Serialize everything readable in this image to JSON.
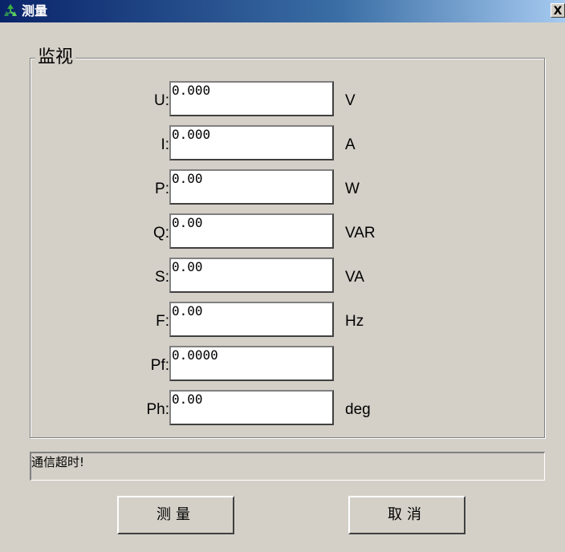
{
  "window": {
    "title": "测量",
    "close_label": "X"
  },
  "group": {
    "label": "监视"
  },
  "measurements": [
    {
      "label": "U:",
      "value": "0.000",
      "unit": "V"
    },
    {
      "label": "I:",
      "value": "0.000",
      "unit": "A"
    },
    {
      "label": "P:",
      "value": "0.00",
      "unit": "W"
    },
    {
      "label": "Q:",
      "value": "0.00",
      "unit": "VAR"
    },
    {
      "label": "S:",
      "value": "0.00",
      "unit": "VA"
    },
    {
      "label": "F:",
      "value": "0.00",
      "unit": "Hz"
    },
    {
      "label": "Pf:",
      "value": "0.0000",
      "unit": ""
    },
    {
      "label": "Ph:",
      "value": "0.00",
      "unit": "deg"
    }
  ],
  "status": {
    "text": "通信超时!"
  },
  "buttons": {
    "measure": "测量",
    "cancel": "取消"
  },
  "colors": {
    "dialog_bg": "#d4d0c8",
    "title_bar": "#0a246a"
  },
  "icons": {
    "title": "recycle-arrows-icon"
  }
}
